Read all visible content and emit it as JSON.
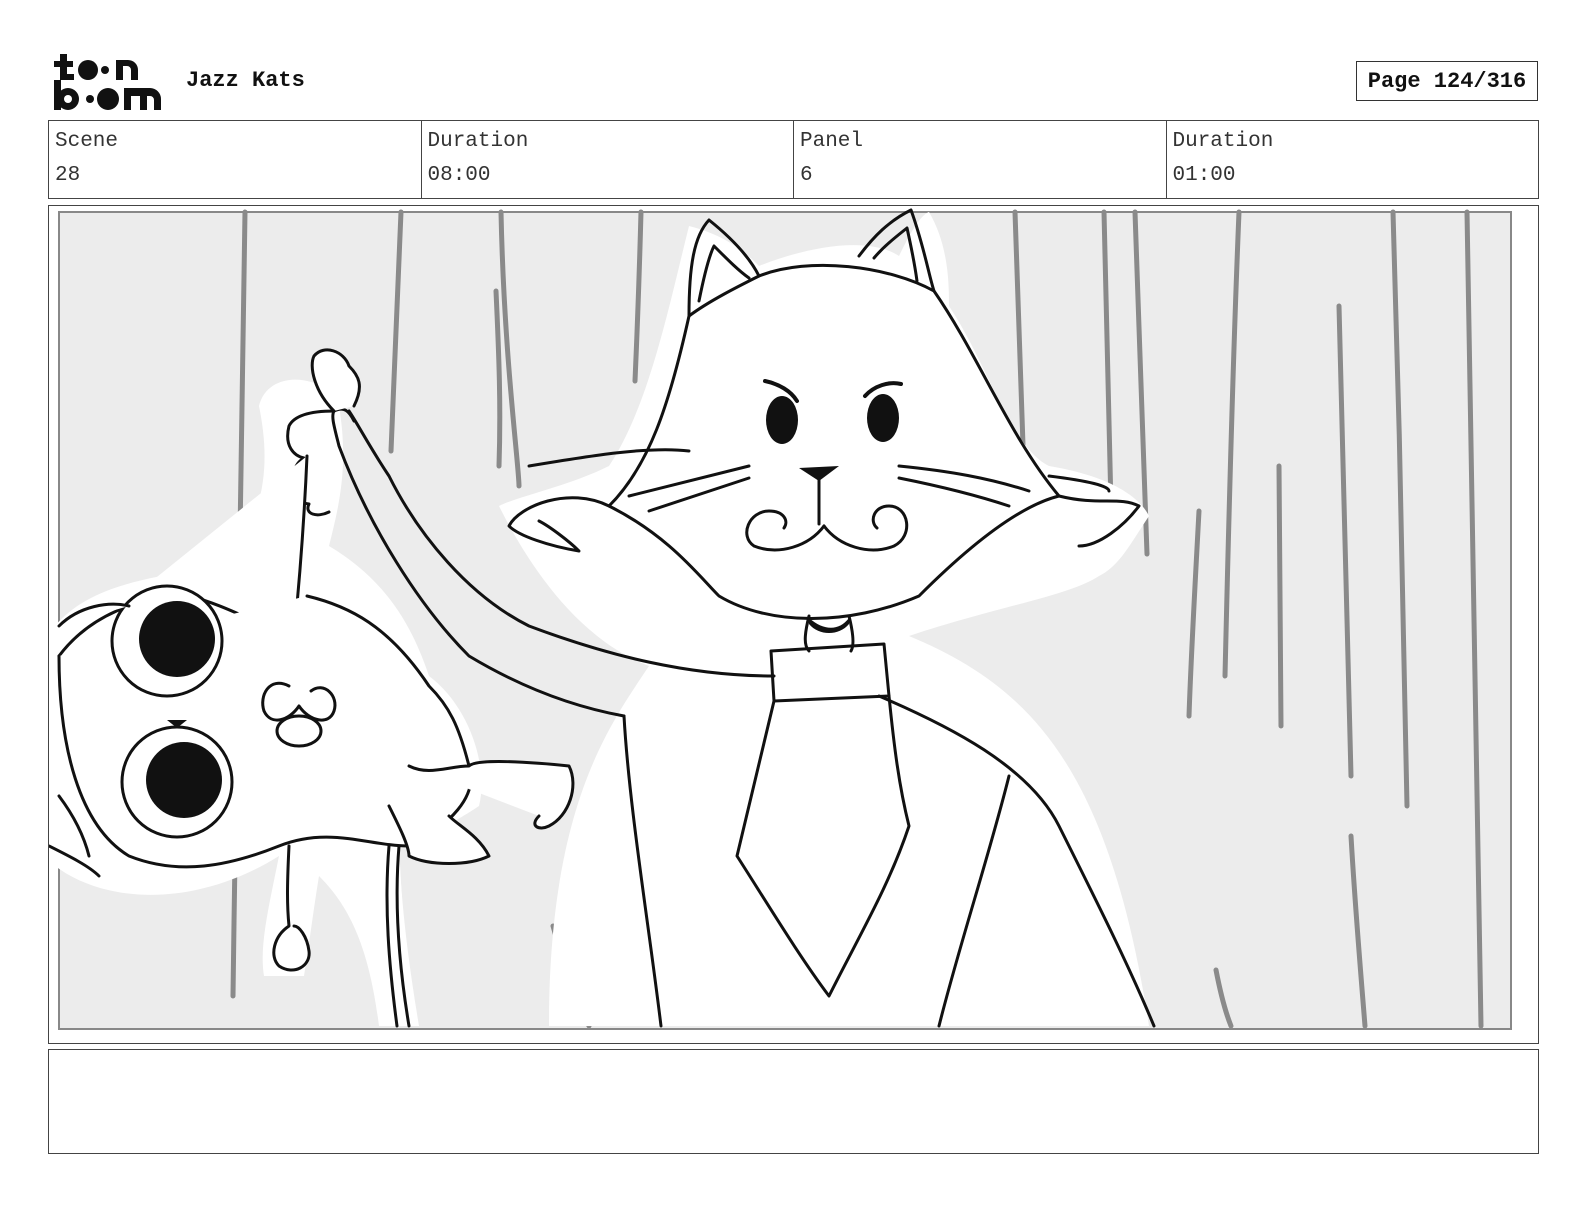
{
  "header": {
    "logo_text_top": "toon",
    "logo_text_bottom": "boom",
    "project_title": "Jazz Kats",
    "page_label": "Page",
    "page_number": "124/316"
  },
  "info": {
    "scene_label": "Scene",
    "scene_value": "28",
    "scene_duration_label": "Duration",
    "scene_duration_value": "08:00",
    "panel_label": "Panel",
    "panel_value": "6",
    "panel_duration_label": "Duration",
    "panel_duration_value": "01:00"
  },
  "notes": {
    "text": ""
  }
}
